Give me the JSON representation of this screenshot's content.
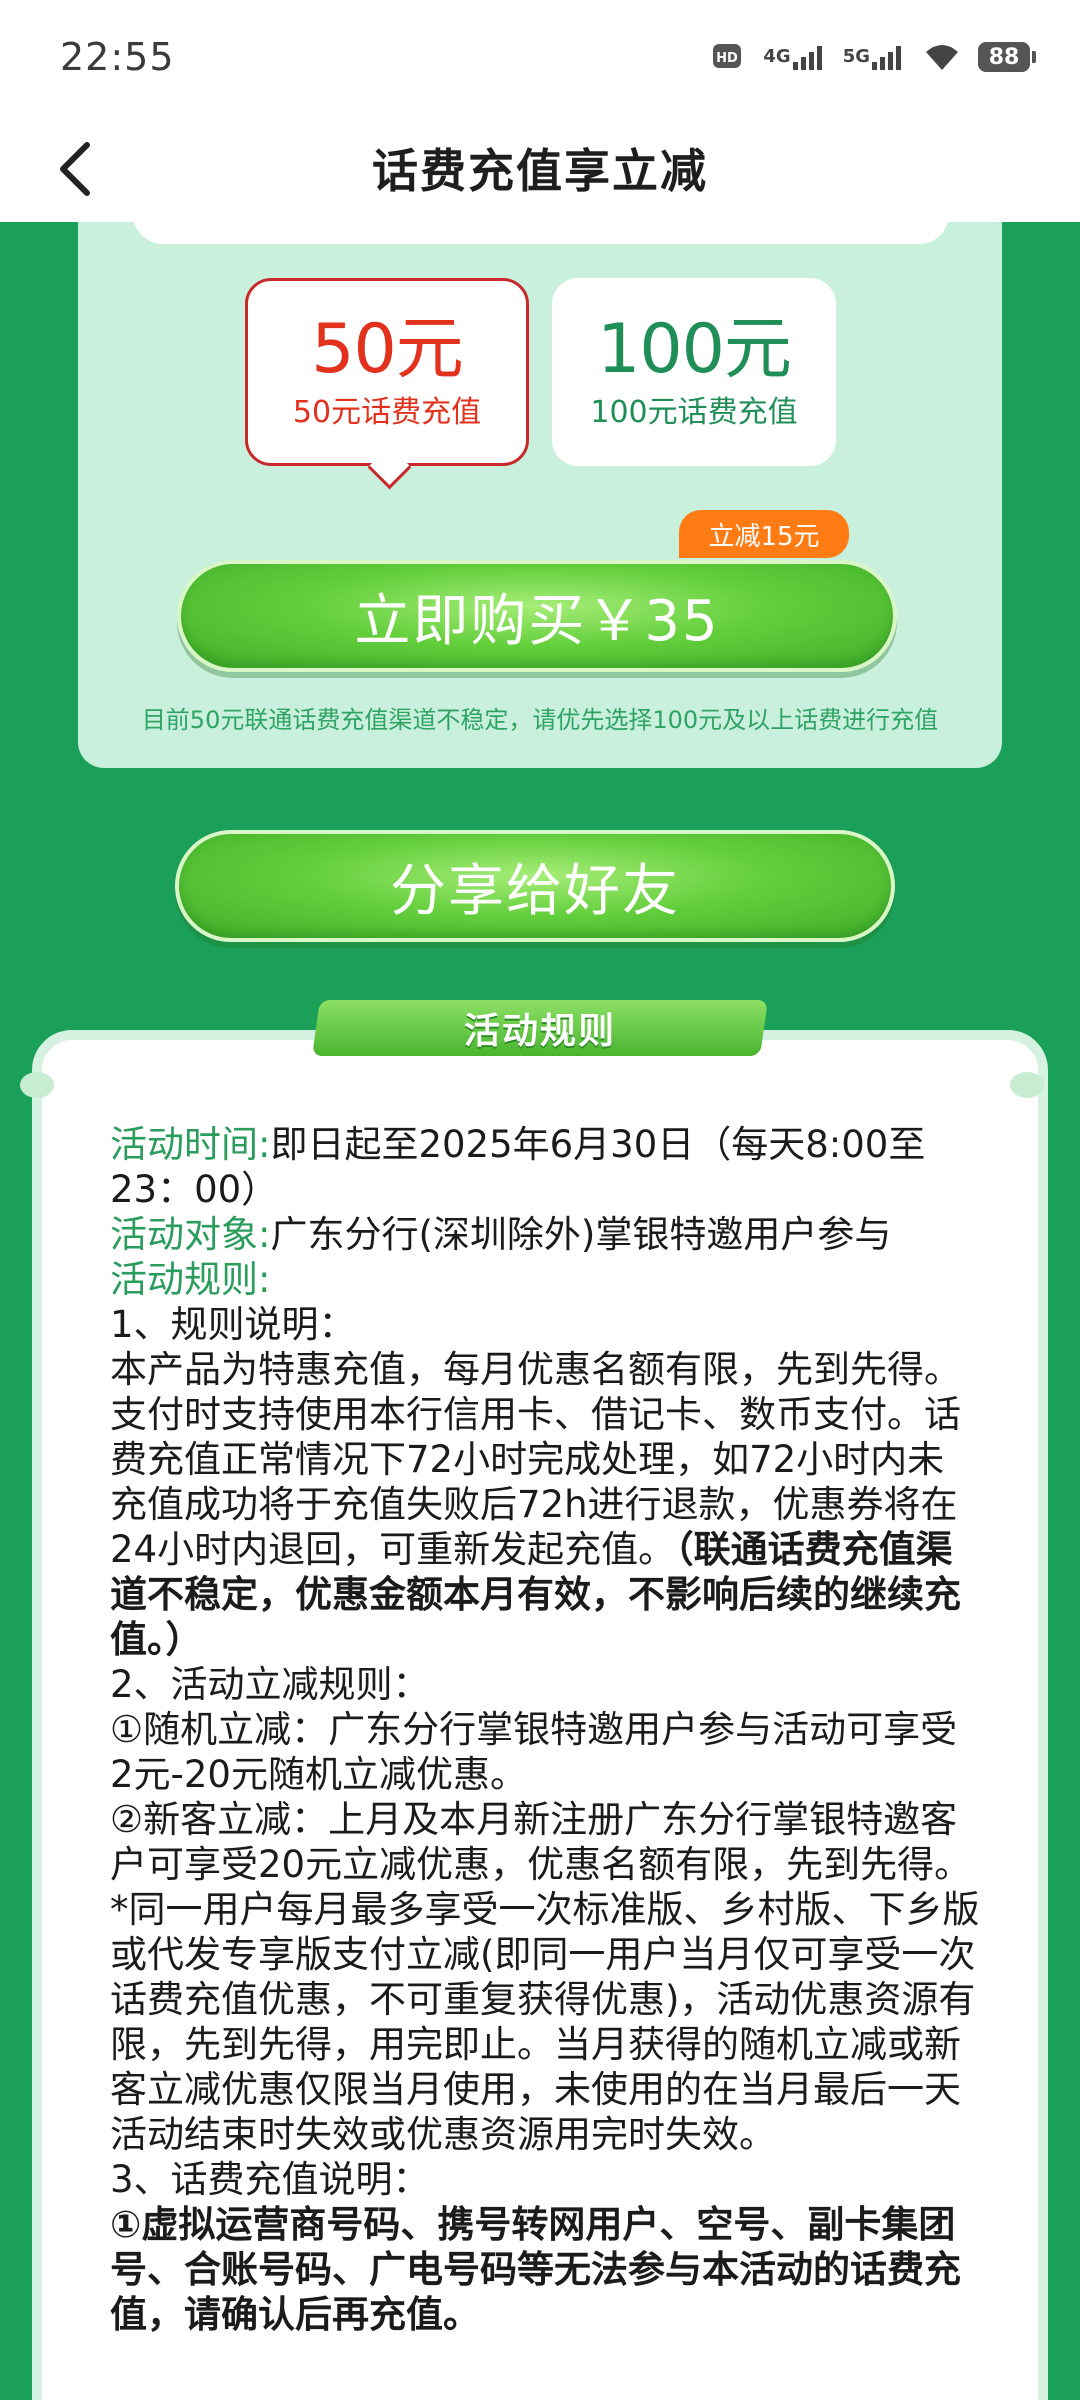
{
  "status_bar": {
    "time": "22:55",
    "hd": "HD",
    "sim1": "4G",
    "sim2": "5G",
    "battery": "88"
  },
  "header": {
    "title": "话费充值享立减"
  },
  "options": [
    {
      "amount": "50元",
      "desc": "50元话费充值",
      "selected": true
    },
    {
      "amount": "100元",
      "desc": "100元话费充值",
      "selected": false
    }
  ],
  "discount_badge": "立减15元",
  "buy_button": "立即购买￥35",
  "notice": "目前50元联通话费充值渠道不稳定，请优先选择100元及以上话费进行充值",
  "share_button": "分享给好友",
  "rules": {
    "tab_title": "活动规则",
    "time_label": "活动时间:",
    "time_value": "即日起至2025年6月30日（每天8:00至23：00）",
    "target_label": "活动对象:",
    "target_value": "广东分行(深圳除外)掌银特邀用户参与",
    "rules_label": "活动规则:",
    "sec1_title": "1、规则说明：",
    "sec1_body": "本产品为特惠充值，每月优惠名额有限，先到先得。支付时支持使用本行信用卡、借记卡、数币支付。话费充值正常情况下72小时完成处理，如72小时内未充值成功将于充值失败后72h进行退款，优惠券将在24小时内退回，可重新发起充值。",
    "sec1_bold": "（联通话费充值渠道不稳定，优惠金额本月有效，不影响后续的继续充值。）",
    "sec2_title": "2、活动立减规则：",
    "sec2_item1": "①随机立减：广东分行掌银特邀用户参与活动可享受2元-20元随机立减优惠。",
    "sec2_item2": "②新客立减：上月及本月新注册广东分行掌银特邀客户可享受20元立减优惠，优惠名额有限，先到先得。",
    "sec2_note": "*同一用户每月最多享受一次标准版、乡村版、下乡版或代发专享版支付立减(即同一用户当月仅可享受一次话费充值优惠，不可重复获得优惠)，活动优惠资源有限，先到先得，用完即止。当月获得的随机立减或新客立减优惠仅限当月使用，未使用的在当月最后一天活动结束时失效或优惠资源用完时失效。",
    "sec3_title": "3、话费充值说明：",
    "sec3_bold": "①虚拟运营商号码、携号转网用户、空号、副卡集团号、合账号码、广电号码等无法参与本活动的话费充值，请确认后再充值。"
  },
  "colors": {
    "page_bg": "#1aa059",
    "card_bg": "#c8f0dc",
    "accent_red": "#e2321e",
    "accent_green": "#1f8f57",
    "badge_orange": "#ff7b14"
  }
}
